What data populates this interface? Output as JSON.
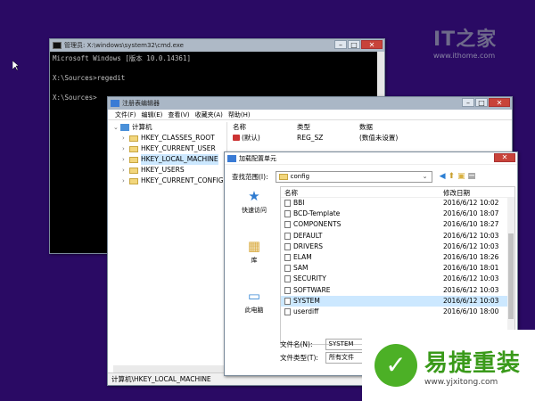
{
  "watermark": {
    "brand": "IT之家",
    "url": "www.ithome.com"
  },
  "cmd": {
    "title": "管理员: X:\\windows\\system32\\cmd.exe",
    "lines": [
      "Microsoft Windows [版本 10.0.14361]",
      "",
      "X:\\Sources>regedit",
      "",
      "X:\\Sources>"
    ]
  },
  "regedit": {
    "title": "注册表编辑器",
    "menu": [
      "文件(F)",
      "编辑(E)",
      "查看(V)",
      "收藏夹(A)",
      "帮助(H)"
    ],
    "tree": {
      "root": "计算机",
      "items": [
        "HKEY_CLASSES_ROOT",
        "HKEY_CURRENT_USER",
        "HKEY_LOCAL_MACHINE",
        "HKEY_USERS",
        "HKEY_CURRENT_CONFIG"
      ]
    },
    "columns": {
      "name": "名称",
      "type": "类型",
      "data": "数据"
    },
    "value": {
      "name": "(默认)",
      "type": "REG_SZ",
      "data": "(数值未设置)"
    },
    "status": "计算机\\HKEY_LOCAL_MACHINE"
  },
  "dialog": {
    "title": "加载配置单元",
    "look_in_label": "查找范围(I):",
    "look_in_value": "config",
    "places": [
      {
        "label": "快速访问",
        "icon": "star-icon"
      },
      {
        "label": "库",
        "icon": "library-icon"
      },
      {
        "label": "此电脑",
        "icon": "computer-icon"
      }
    ],
    "col_name": "名称",
    "col_date": "修改日期",
    "files": [
      [
        "BBI",
        "2016/6/12 10:02"
      ],
      [
        "BCD-Template",
        "2016/6/10 18:07"
      ],
      [
        "COMPONENTS",
        "2016/6/10 18:27"
      ],
      [
        "DEFAULT",
        "2016/6/12 10:03"
      ],
      [
        "DRIVERS",
        "2016/6/12 10:03"
      ],
      [
        "ELAM",
        "2016/6/10 18:26"
      ],
      [
        "SAM",
        "2016/6/10 18:01"
      ],
      [
        "SECURITY",
        "2016/6/12 10:03"
      ],
      [
        "SOFTWARE",
        "2016/6/12 10:03"
      ],
      [
        "SYSTEM",
        "2016/6/12 10:03"
      ],
      [
        "userdiff",
        "2016/6/10 18:00"
      ]
    ],
    "filename_label": "文件名(N):",
    "filename_value": "SYSTEM",
    "filetype_label": "文件类型(T):",
    "filetype_value": "所有文件"
  },
  "logo": {
    "name": "易捷重装",
    "url": "www.yjxitong.com"
  }
}
